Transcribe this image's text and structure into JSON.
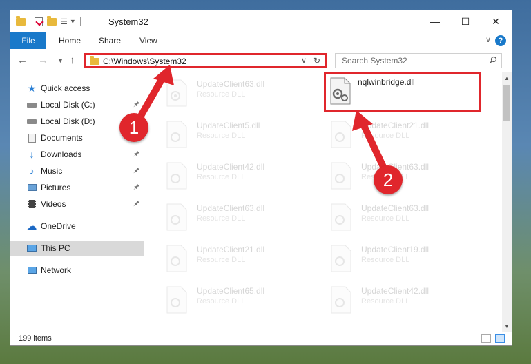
{
  "window": {
    "title": "System32"
  },
  "ribbon": {
    "tabs": [
      "File",
      "Home",
      "Share",
      "View"
    ],
    "help": "?"
  },
  "address": {
    "path": "C:\\Windows\\System32"
  },
  "search": {
    "placeholder": "Search System32"
  },
  "nav": {
    "items": [
      {
        "label": "Quick access",
        "icon": "star-icon",
        "pinned": false
      },
      {
        "label": "Local Disk (C:)",
        "icon": "drive-icon",
        "pinned": true
      },
      {
        "label": "Local Disk (D:)",
        "icon": "drive-icon",
        "pinned": false
      },
      {
        "label": "Documents",
        "icon": "documents-icon",
        "pinned": false
      },
      {
        "label": "Downloads",
        "icon": "download-icon",
        "pinned": true
      },
      {
        "label": "Music",
        "icon": "music-icon",
        "pinned": true
      },
      {
        "label": "Pictures",
        "icon": "pictures-icon",
        "pinned": true
      },
      {
        "label": "Videos",
        "icon": "videos-icon",
        "pinned": true
      },
      {
        "label": "OneDrive",
        "icon": "cloud-icon",
        "pinned": false
      },
      {
        "label": "This PC",
        "icon": "monitor-icon",
        "pinned": false,
        "selected": true
      },
      {
        "label": "Network",
        "icon": "network-icon",
        "pinned": false
      }
    ]
  },
  "files": [
    {
      "name": "UpdateClient63.dll",
      "type": "Resource DLL"
    },
    {
      "name": "nqlwinbridge.dll",
      "type": ""
    },
    {
      "name": "UpdateClient5.dll",
      "type": "Resource DLL"
    },
    {
      "name": "UpdateClient21.dll",
      "type": "Resource DLL"
    },
    {
      "name": "UpdateClient42.dll",
      "type": "Resource DLL"
    },
    {
      "name": "UpdateClient63.dll",
      "type": "Resource DLL"
    },
    {
      "name": "UpdateClient63.dll",
      "type": "Resource DLL"
    },
    {
      "name": "UpdateClient63.dll",
      "type": "Resource DLL"
    },
    {
      "name": "UpdateClient21.dll",
      "type": "Resource DLL"
    },
    {
      "name": "UpdateClient19.dll",
      "type": "Resource DLL"
    },
    {
      "name": "UpdateClient65.dll",
      "type": "Resource DLL"
    },
    {
      "name": "UpdateClient42.dll",
      "type": "Resource DLL"
    }
  ],
  "status": {
    "item_count": "199 items"
  },
  "annotations": {
    "step1": "1",
    "step2": "2",
    "color": "#e0262c"
  },
  "colors": {
    "accent": "#1979ca",
    "highlight": "#e0262c"
  }
}
